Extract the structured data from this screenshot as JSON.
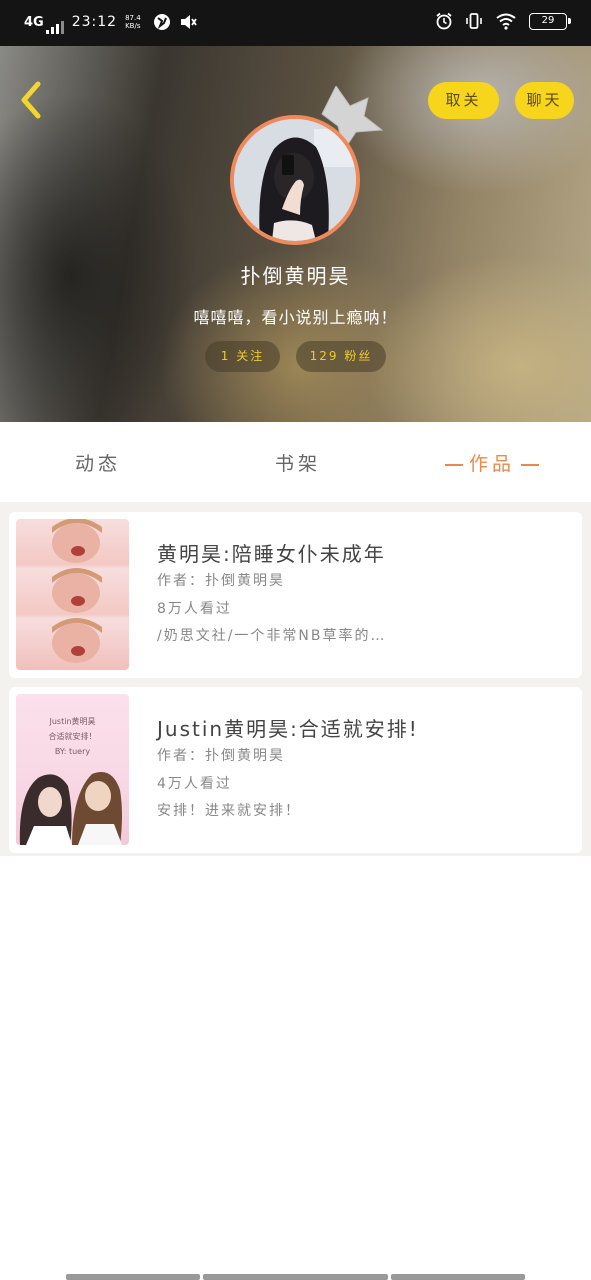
{
  "status_bar": {
    "network": "4G",
    "time": "23:12",
    "speed_value": "87.4",
    "speed_unit": "KB/s",
    "battery": "29"
  },
  "profile": {
    "follow_button": "取关",
    "chat_button": "聊天",
    "username": "扑倒黄明昊",
    "bio": "嘻嘻嘻，看小说别上瘾呐！",
    "following": "1 关注",
    "fans": "129 粉丝"
  },
  "tabs": {
    "dongtai": "动态",
    "shujia": "书架",
    "zuopin": "作品"
  },
  "works": [
    {
      "title": "黄明昊:陪睡女仆未成年",
      "author": "作者：扑倒黄明昊",
      "views": "8万人看过",
      "desc": "/奶思文社/一个非常NB草率的…"
    },
    {
      "title": "Justin黄明昊:合适就安排!",
      "author": "作者：扑倒黄明昊",
      "views": "4万人看过",
      "desc": "安排！进来就安排！",
      "cover_text": [
        "Justin黄明昊",
        "合适就安排！",
        "BY: tuery"
      ]
    }
  ],
  "colors": {
    "accent_yellow": "#f7d51c",
    "tab_active": "#e88a4f",
    "avatar_border": "#f08a5a"
  }
}
